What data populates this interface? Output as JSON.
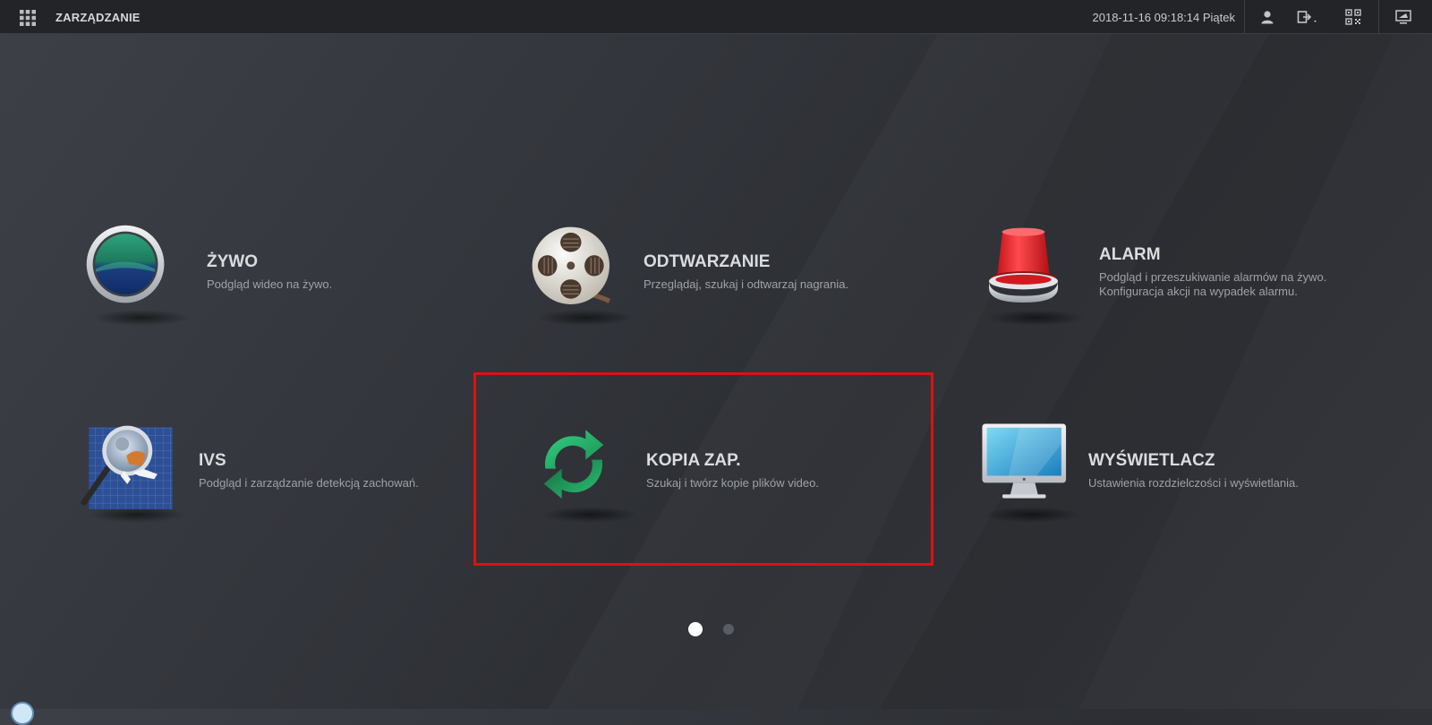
{
  "header": {
    "title": "ZARZĄDZANIE",
    "datetime": "2018-11-16 09:18:14 Piątek",
    "icons": [
      "grid-menu-icon",
      "user-icon",
      "logout-icon",
      "qr-code-icon",
      "display-icon"
    ]
  },
  "cards": [
    {
      "id": "live",
      "title": "ŻYWO",
      "desc": [
        "Podgląd wideo na żywo."
      ],
      "icon": "live-view-icon"
    },
    {
      "id": "playback",
      "title": "ODTWARZANIE",
      "desc": [
        "Przeglądaj, szukaj i odtwarzaj nagrania."
      ],
      "icon": "film-reel-icon"
    },
    {
      "id": "alarm",
      "title": "ALARM",
      "desc": [
        "Podgląd i przeszukiwanie alarmów na żywo.",
        "Konfiguracja akcji na wypadek alarmu."
      ],
      "icon": "alarm-siren-icon"
    },
    {
      "id": "ivs",
      "title": "IVS",
      "desc": [
        "Podgląd i zarządzanie detekcją zachowań."
      ],
      "icon": "magnifier-icon"
    },
    {
      "id": "backup",
      "title": "KOPIA ZAP.",
      "desc": [
        "Szukaj i twórz kopie plików video."
      ],
      "icon": "backup-sync-icon"
    },
    {
      "id": "display",
      "title": "WYŚWIETLACZ",
      "desc": [
        "Ustawienia rozdzielczości i wyświetlania."
      ],
      "icon": "monitor-icon"
    }
  ],
  "pagination": {
    "pages": 2,
    "current": 1
  },
  "colors": {
    "highlight": "#e01010",
    "backup_green": "#22b567",
    "alarm_red": "#e8262a"
  }
}
